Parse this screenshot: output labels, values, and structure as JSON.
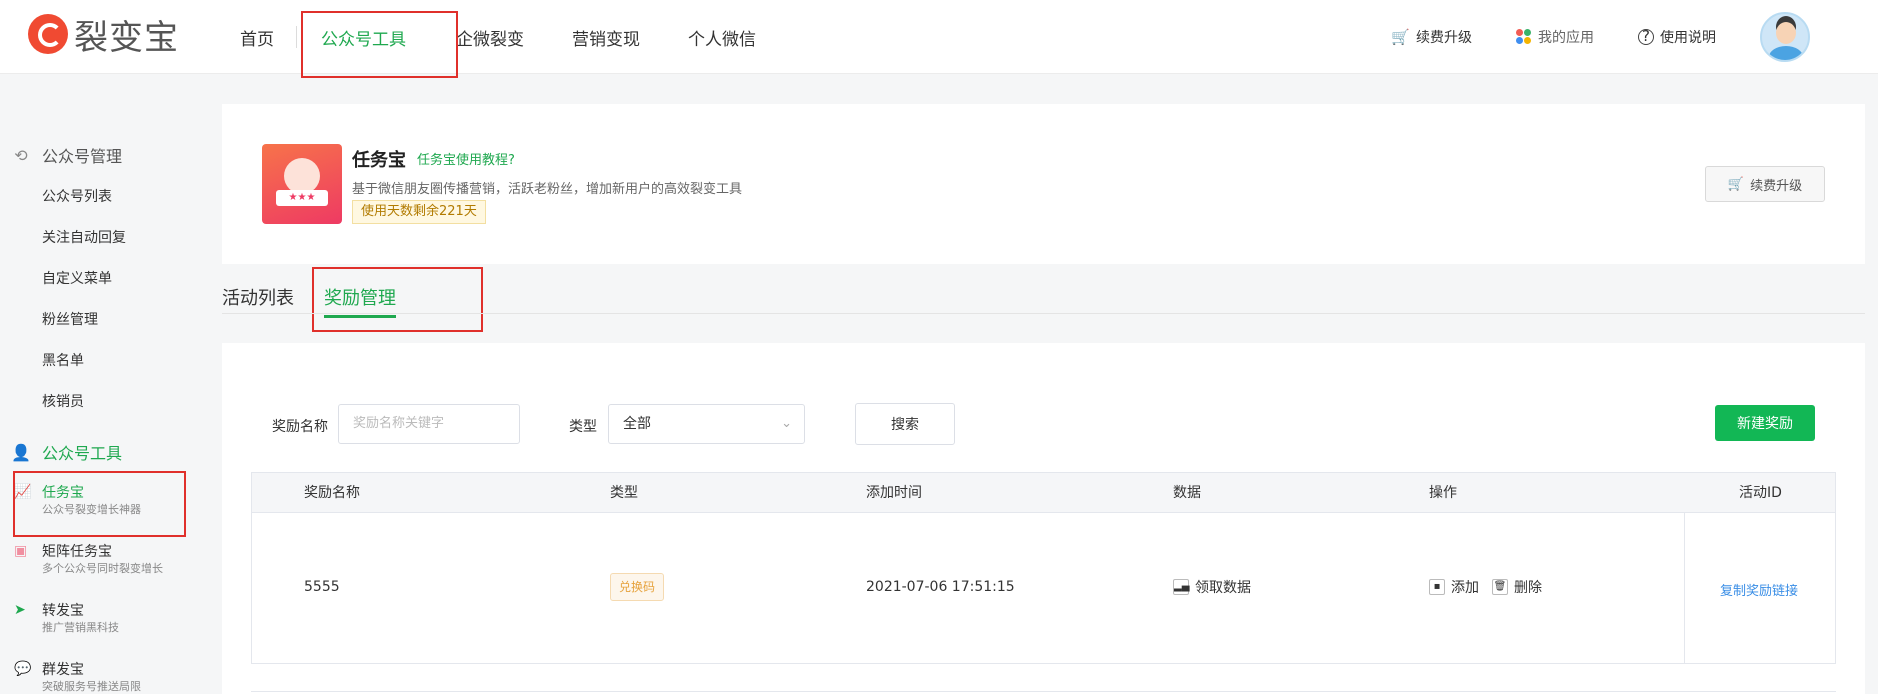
{
  "brand": {
    "name": "裂变宝",
    "accent": "#1fa84f",
    "logo_color": "#f04a32"
  },
  "nav": {
    "items": [
      {
        "label": "首页"
      },
      {
        "label": "公众号工具",
        "active": true
      },
      {
        "label": "企微裂变"
      },
      {
        "label": "营销变现"
      },
      {
        "label": "个人微信"
      }
    ]
  },
  "header_right": {
    "renew": "续费升级",
    "my_apps": "我的应用",
    "help": "使用说明"
  },
  "sidebar": {
    "group1": {
      "label": "公众号管理",
      "icon": "refresh-icon"
    },
    "group1_items": [
      "公众号列表",
      "关注自动回复",
      "自定义菜单",
      "粉丝管理",
      "黑名单",
      "核销员"
    ],
    "group2": {
      "label": "公众号工具",
      "icon": "user-icon"
    },
    "tools": [
      {
        "title": "任务宝",
        "subtitle": "公众号裂变增长神器",
        "active": true
      },
      {
        "title": "矩阵任务宝",
        "subtitle": "多个公众号同时裂变增长"
      },
      {
        "title": "转发宝",
        "subtitle": "推广营销黑科技"
      },
      {
        "title": "群发宝",
        "subtitle": "突破服务号推送局限"
      }
    ]
  },
  "app": {
    "title": "任务宝",
    "tutorial_link": "任务宝使用教程?",
    "description": "基于微信朋友圈传播营销，活跃老粉丝，增加新用户的高效裂变工具",
    "days_left": "使用天数剩余221天",
    "renew_button": "续费升级"
  },
  "tabs": [
    {
      "label": "活动列表"
    },
    {
      "label": "奖励管理",
      "active": true
    }
  ],
  "filter": {
    "name_label": "奖励名称",
    "name_placeholder": "奖励名称关键字",
    "type_label": "类型",
    "type_value": "全部",
    "search_button": "搜索",
    "new_button": "新建奖励"
  },
  "table": {
    "columns": [
      "奖励名称",
      "类型",
      "添加时间",
      "数据",
      "操作",
      "活动ID"
    ],
    "rows": [
      {
        "name": "5555",
        "type": "兑换码",
        "added": "2021-07-06 17:51:15",
        "data_action": "领取数据",
        "op_add": "添加",
        "op_delete": "删除",
        "copy_link": "复制奖励链接"
      }
    ]
  }
}
